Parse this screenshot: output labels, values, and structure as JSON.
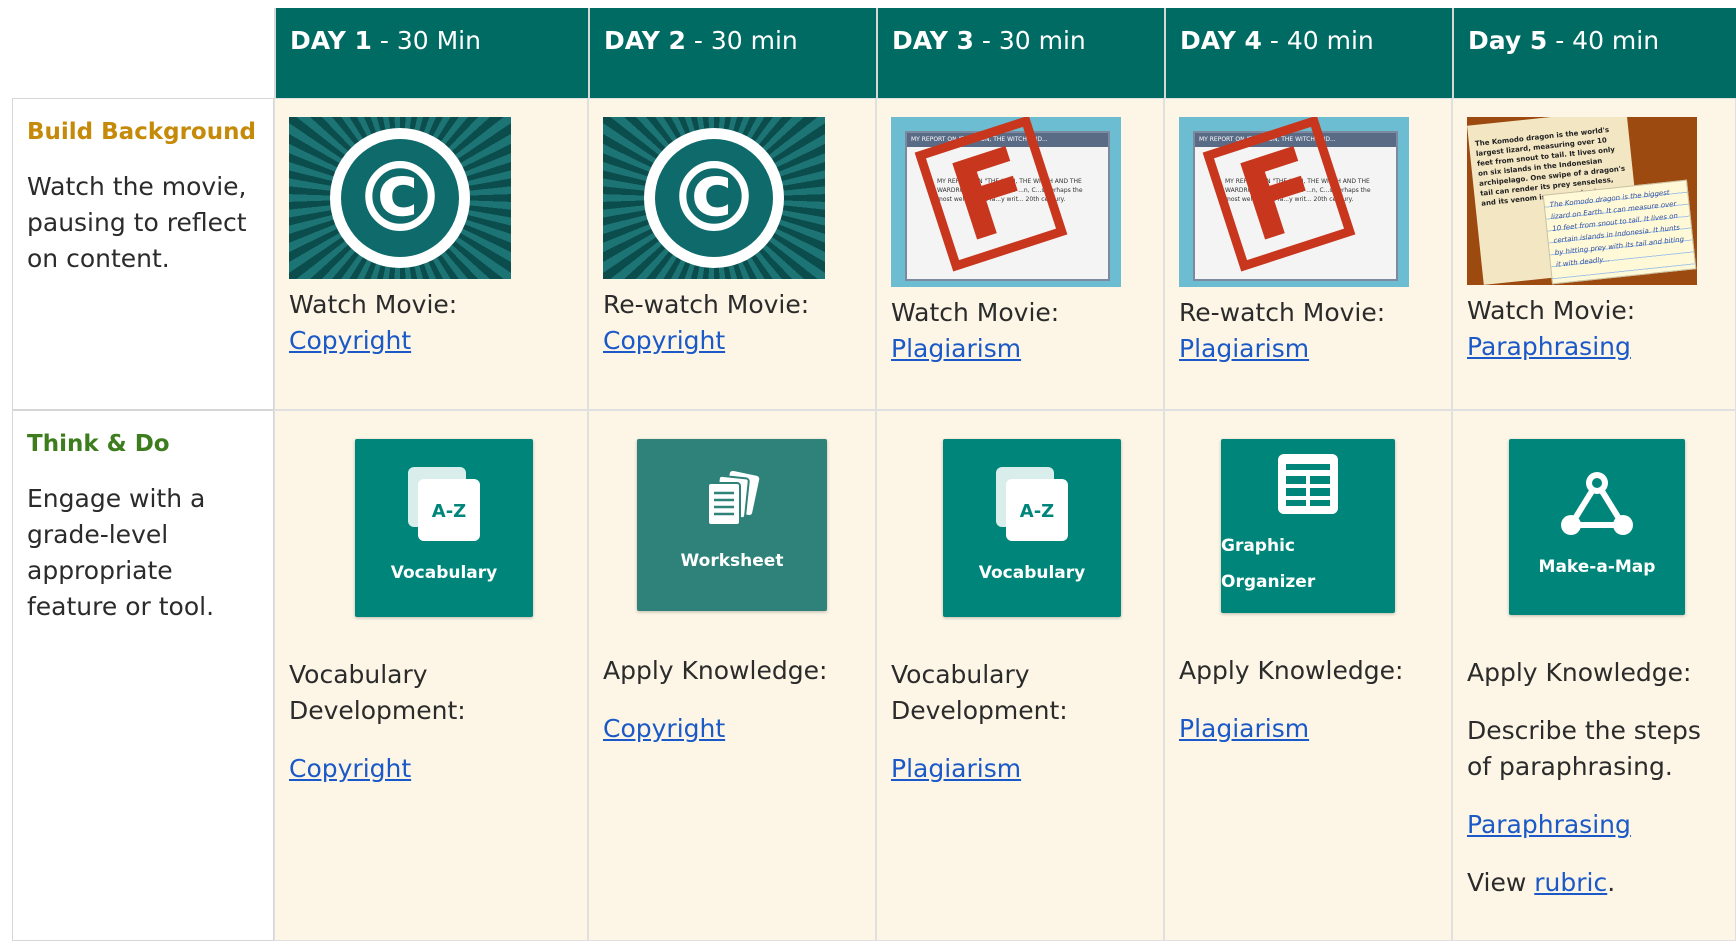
{
  "headers": [
    {
      "day": "DAY 1",
      "time": " - 30 Min"
    },
    {
      "day": "DAY 2",
      "time": " - 30 min"
    },
    {
      "day": "DAY 3",
      "time": " - 30 min"
    },
    {
      "day": "DAY 4",
      "time": " - 40 min"
    },
    {
      "day": "Day 5",
      "time": " - 40 min"
    }
  ],
  "rows": {
    "build": {
      "title": "Build Background",
      "desc": "Watch the movie, pausing to reflect on content.",
      "cells": [
        {
          "label": "Watch Movie:",
          "link": "Copyright",
          "thumb": "copyright-icon"
        },
        {
          "label": "Re-watch Movie:",
          "link": "Copyright",
          "thumb": "copyright-icon"
        },
        {
          "label": "Watch Movie:",
          "link": "Plagiarism",
          "thumb": "plagiarism-thumbnail"
        },
        {
          "label": "Re-watch Movie:",
          "link": "Plagiarism",
          "thumb": "plagiarism-thumbnail"
        },
        {
          "label": "Watch Movie:",
          "link": "Paraphrasing",
          "thumb": "paraphrasing-thumbnail"
        }
      ]
    },
    "think": {
      "title": "Think & Do",
      "desc": "Engage with a grade-level appropriate feature or tool.",
      "cells": [
        {
          "tile": "Vocabulary",
          "label": "Vocabulary Development:",
          "link": "Copyright"
        },
        {
          "tile": "Worksheet",
          "label": "Apply Knowledge:",
          "link": "Copyright"
        },
        {
          "tile": "Vocabulary",
          "label": "Vocabulary Development:",
          "link": "Plagiarism"
        },
        {
          "tile": "Graphic Organizer",
          "label": "Apply Knowledge:",
          "link": "Plagiarism"
        },
        {
          "tile": "Make-a-Map",
          "label": "Apply Knowledge:",
          "extra": "Describe the steps of paraphrasing.",
          "link": "Paraphrasing",
          "view_prefix": "View ",
          "view_link": "rubric",
          "view_suffix": "."
        }
      ]
    }
  },
  "thumb_text": {
    "win_title": "MY REPORT ON \"THE LION, THE WITCH AND...",
    "win_body": "MY REPORT ON \"THE LION, THE WITCH AND THE WARDROBE\" ...ssian. After ...n, C...s perhaps the most well-known fa...y writ... 20th century.",
    "stamp": "F",
    "para_main": "The Komodo dragon is the world's largest lizard, measuring over 10 feet from snout to tail. It lives only on six islands in the Indonesian archipelago. One swipe of a dragon's tail can render its prey senseless, and its venom is as...a cobra's.",
    "para_note": "The Komodo dragon is the biggest lizard on Earth. It can measure over 10 feet from snout to tail. It lives on certain islands in Indonesia. It hunts by hitting prey with its tail and biting it with deadly...",
    "az": "A-Z"
  },
  "colors": {
    "header": "#006b63",
    "tile": "#00857a",
    "cell_bg": "#fdf6e6",
    "link": "#1a59c7",
    "gold": "#c68a0a",
    "green": "#3d7d1e"
  }
}
